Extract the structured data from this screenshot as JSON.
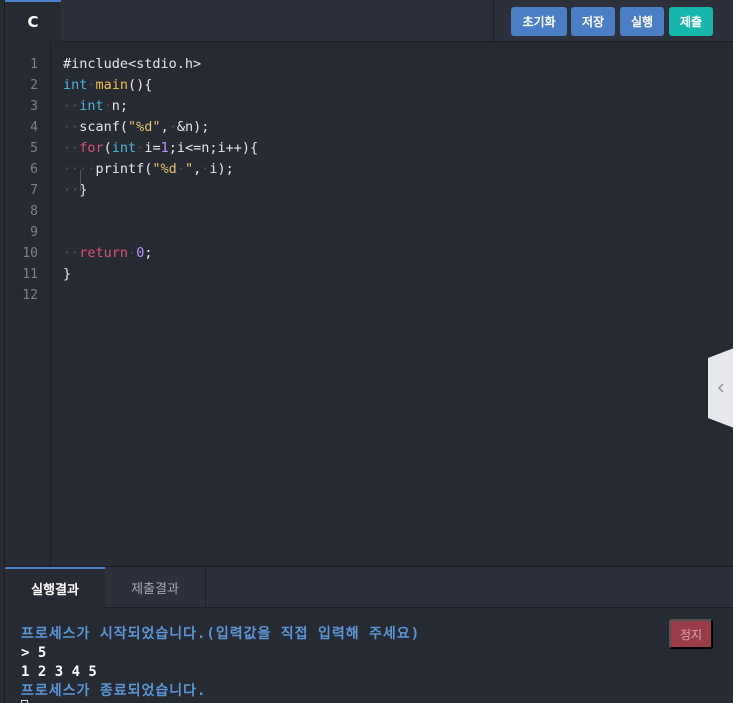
{
  "toolbar": {
    "language": "C",
    "reset_label": "초기화",
    "save_label": "저장",
    "run_label": "실행",
    "submit_label": "제출",
    "colors": {
      "button": "#4a7fc5",
      "submit": "#17b6ad"
    }
  },
  "editor": {
    "line_numbers": [
      "1",
      "2",
      "3",
      "4",
      "5",
      "6",
      "7",
      "8",
      "9",
      "10",
      "11",
      "12"
    ],
    "lines": [
      [
        {
          "t": "#include<stdio.h>",
          "c": "pl"
        }
      ],
      [
        {
          "t": "int",
          "c": "type"
        },
        {
          "t": "·",
          "c": "dot"
        },
        {
          "t": "main",
          "c": "fn"
        },
        {
          "t": "(){",
          "c": "pl"
        }
      ],
      [
        {
          "t": "··",
          "c": "dot"
        },
        {
          "t": "int",
          "c": "type"
        },
        {
          "t": "·",
          "c": "dot"
        },
        {
          "t": "n;",
          "c": "pl"
        }
      ],
      [
        {
          "t": "··",
          "c": "dot"
        },
        {
          "t": "scanf(",
          "c": "pl"
        },
        {
          "t": "\"%d\"",
          "c": "str"
        },
        {
          "t": ",",
          "c": "pl"
        },
        {
          "t": "·",
          "c": "dot"
        },
        {
          "t": "&n);",
          "c": "pl"
        }
      ],
      [
        {
          "t": "··",
          "c": "dot"
        },
        {
          "t": "for",
          "c": "kw"
        },
        {
          "t": "(",
          "c": "pl"
        },
        {
          "t": "int",
          "c": "type"
        },
        {
          "t": "·",
          "c": "dot"
        },
        {
          "t": "i=",
          "c": "pl"
        },
        {
          "t": "1",
          "c": "num"
        },
        {
          "t": ";i<=n;i++){",
          "c": "pl"
        }
      ],
      [
        {
          "t": "····",
          "c": "dot"
        },
        {
          "t": "printf(",
          "c": "pl"
        },
        {
          "t": "\"%d",
          "c": "str"
        },
        {
          "t": "·",
          "c": "dot"
        },
        {
          "t": "\"",
          "c": "str"
        },
        {
          "t": ",",
          "c": "pl"
        },
        {
          "t": "·",
          "c": "dot"
        },
        {
          "t": "i);",
          "c": "pl"
        }
      ],
      [
        {
          "t": "··",
          "c": "dot"
        },
        {
          "t": "}",
          "c": "pl"
        }
      ],
      [],
      [],
      [
        {
          "t": "··",
          "c": "dot"
        },
        {
          "t": "return",
          "c": "kw"
        },
        {
          "t": "·",
          "c": "dot"
        },
        {
          "t": "0",
          "c": "num"
        },
        {
          "t": ";",
          "c": "pl"
        }
      ],
      [
        {
          "t": "}",
          "c": "pl"
        }
      ],
      []
    ]
  },
  "bottom": {
    "tab_run_result": "실행결과",
    "tab_submit_result": "제출결과",
    "stop_label": "정지",
    "console": [
      {
        "text": "프로세스가 시작되었습니다.(입력값을 직접 입력해 주세요)",
        "kind": "info"
      },
      {
        "text": "> 5",
        "kind": "out"
      },
      {
        "text": "1 2 3 4 5",
        "kind": "out"
      },
      {
        "text": "프로세스가 종료되었습니다.",
        "kind": "info"
      }
    ]
  },
  "icons": {
    "collapse": "chevron-left-icon"
  }
}
